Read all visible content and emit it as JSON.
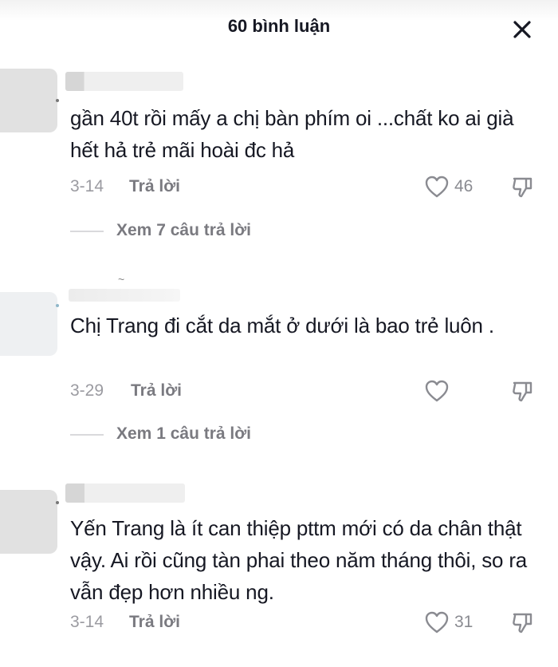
{
  "header": {
    "title": "60 bình luận"
  },
  "comments": [
    {
      "text": "gần 40t rồi mấy a chị bàn phím oi ...chất ko ai già hết hả trẻ mãi hoài đc hả",
      "date": "3-14",
      "reply_label": "Trả lời",
      "likes": "46",
      "view_replies": "Xem 7 câu trả lời"
    },
    {
      "text": "Chị Trang đi cắt da mắt ở dưới là bao trẻ luôn .",
      "date": "3-29",
      "reply_label": "Trả lời",
      "likes": "",
      "view_replies": "Xem 1 câu trả lời"
    },
    {
      "text": "Yến Trang là ít can thiệp pttm mới có da chân thật vậy. Ai rồi cũng tàn phai theo năm tháng thôi, so ra vẫn đẹp hơn nhiều ng.",
      "date": "3-14",
      "reply_label": "Trả lời",
      "likes": "31",
      "view_replies": ""
    }
  ],
  "icons": {
    "close": "close-icon",
    "like": "heart-icon",
    "dislike": "thumbs-down-icon"
  },
  "colors": {
    "text": "#161823",
    "meta": "#9b9ba1",
    "secondary": "#7a7a80"
  }
}
